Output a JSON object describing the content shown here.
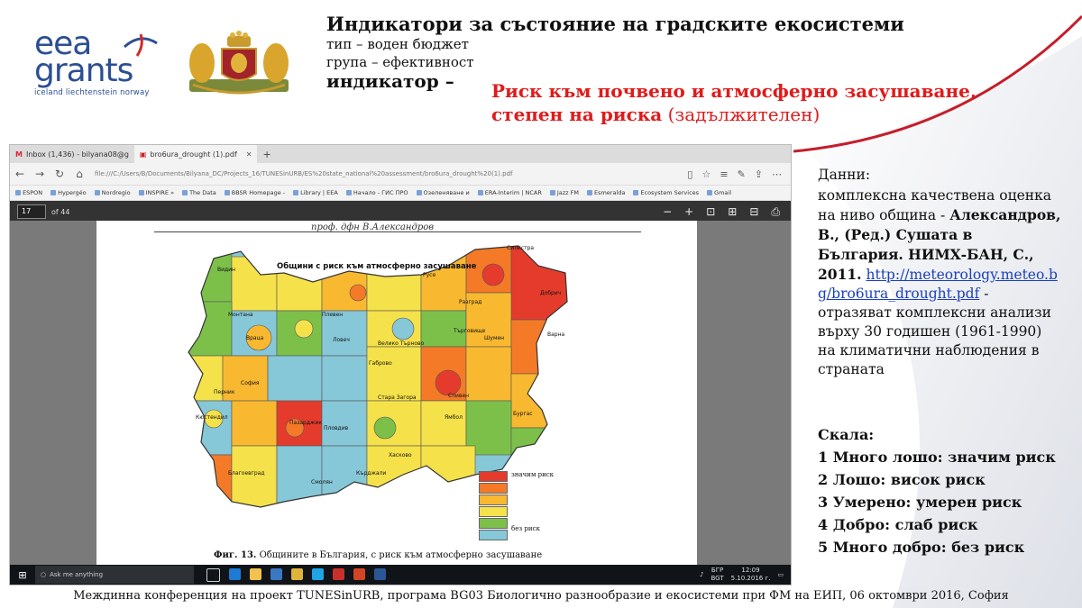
{
  "header": {
    "logo": {
      "line1": "eea",
      "line2": "grants",
      "line3": "iceland liechtenstein norway"
    },
    "title": "Индикатори за състояние на градските екосистеми",
    "type_line": "тип – воден бюджет",
    "group_line": "група – ефективност",
    "indicator_label": "индикатор –",
    "risk_title_line1": "Риск към почвено и атмосферно засушаване,",
    "risk_title_line2_bold": "степен на риска",
    "risk_title_line2_rest": " (задължителен)"
  },
  "browser": {
    "tabs": [
      {
        "label": "Inbox (1,436) - bilyana08@g",
        "icon": "gmail-icon",
        "active": false
      },
      {
        "label": "bro6ura_drought (1).pdf",
        "icon": "pdf-icon",
        "active": true
      }
    ],
    "new_tab": "+",
    "url": "file:///C:/Users/B/Documents/Bilyana_DC/Projects_16/TUNESinURB/ES%20state_national%20assessment/bro6ura_drought%20(1).pdf",
    "favorites": [
      "ESPON",
      "Hypergéo",
      "Nordregio",
      "INSPIRE »",
      "The Data",
      "BBSR Homepage -",
      "Library | EEA",
      "Начало - ГИС ПРО",
      "Озеленяване и",
      "ERA-Interim | NCAR",
      "Jazz FM",
      "Esmeralda",
      "Ecosystem Services",
      "Gmail"
    ],
    "pdf": {
      "page": "17",
      "of": "of 44",
      "author": "проф. дфн В.Александров",
      "map_title": "Общини с риск към атмосферно засушаване",
      "legend_top": "значим риск",
      "legend_bottom": "без риск",
      "legend_colors": [
        "#e53b2c",
        "#f47a28",
        "#f8b830",
        "#f5e14a",
        "#7cc04a",
        "#86c7d8"
      ],
      "caption_bold": "Фиг. 13.",
      "caption_rest": " Общините в България, с риск към атмосферно засушаване",
      "city_labels": [
        "Силистра",
        "Русе",
        "Добрич",
        "Разград",
        "Плевен",
        "Монтана",
        "Враца",
        "Ловеч",
        "Велико Търново",
        "Търговище",
        "Шумен",
        "Варна",
        "Габрово",
        "София",
        "Перник",
        "Стара Загора",
        "Сливен",
        "Ямбол",
        "Бургас",
        "Пазарджик",
        "Пловдив",
        "Хасково",
        "Кърджали",
        "Смолян",
        "Благоевград",
        "Кюстендил",
        "Видин"
      ]
    },
    "taskbar": {
      "search_placeholder": "Ask me anything",
      "lang": "БГР",
      "lang2": "BGT",
      "time": "12:09",
      "date": "5.10.2016 г."
    }
  },
  "info": {
    "data_label": "Данни:",
    "desc": "комплексна качествена оценка на ниво община -",
    "ref": "Александров, В., (Ред.) Сушата в България. НИМХ-БАН, С., 2011.",
    "link": "http://meteorology.meteo.bg/bro6ura_drought.pdf",
    "desc2": " - отразяват комплексни анализи върху 30 годишен (1961-1990) на климатични наблюдения в страната"
  },
  "scale": {
    "label": "Скала:",
    "items": [
      "1 Много лошо: значим риск",
      "2 Лошо: висок риск",
      "3 Умерено: умерен риск",
      "4 Добро: слаб риск",
      "5 Много добро: без риск"
    ]
  },
  "footer": "Междинна конференция на проект TUNESinURB, програма BG03 Биологично разнообразие и екосистеми при ФМ на ЕИП, 06 октомври 2016, София",
  "colors": {
    "accent_red": "#e01b1b",
    "brand_blue": "#2b4f93",
    "link_blue": "#1a3fbf"
  }
}
